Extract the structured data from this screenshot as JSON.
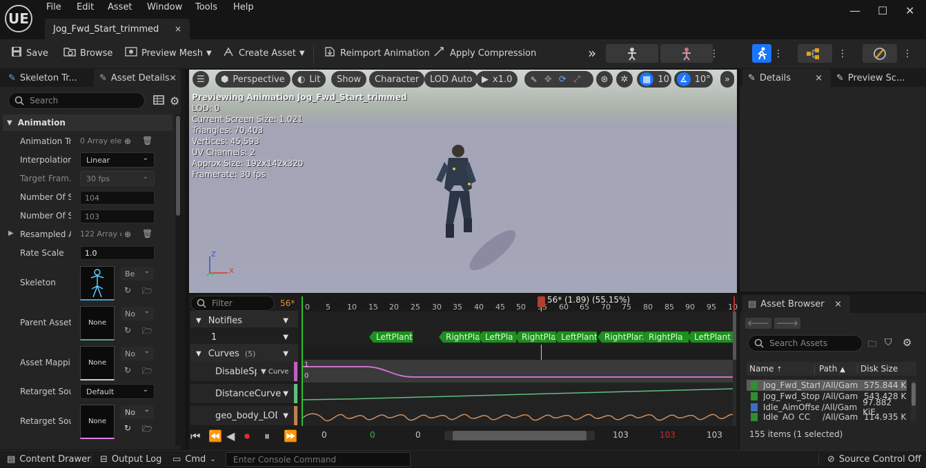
{
  "app": {
    "logo": "UE",
    "document_tab": "Jog_Fwd_Start_trimmed",
    "close_glyph": "×"
  },
  "menu": [
    "File",
    "Edit",
    "Asset",
    "Window",
    "Tools",
    "Help"
  ],
  "window_controls": {
    "minimize": "—",
    "maximize": "☐",
    "close": "✕"
  },
  "toolbar": {
    "save": "Save",
    "browse": "Browse",
    "preview_mesh": "Preview Mesh",
    "create_asset": "Create Asset",
    "reimport": "Reimport Animation",
    "apply_compression": "Apply Compression",
    "overflow": "»"
  },
  "left_panel": {
    "tabs": [
      "Skeleton Tr...",
      "Asset Details"
    ],
    "search_placeholder": "Search",
    "section": "Animation",
    "props": {
      "animation_track_label": "Animation Tr...",
      "animation_track_value": "0 Array ele",
      "interpolation_label": "Interpolation",
      "interpolation_value": "Linear",
      "target_frame_label": "Target Fram...",
      "target_frame_value": "30 fps",
      "num_sampled_keys_label": "Number Of S...",
      "num_sampled_keys_value": "104",
      "num_sampled_frames_label": "Number Of S...",
      "num_sampled_frames_value": "103",
      "resampled_label": "Resampled A...",
      "resampled_value": "122 Array e",
      "rate_scale_label": "Rate Scale",
      "rate_scale_value": "1.0",
      "skeleton_label": "Skeleton",
      "skeleton_combo": "Be",
      "parent_asset_label": "Parent Asset",
      "parent_asset_thumb": "None",
      "parent_asset_combo": "No",
      "asset_mapping_label": "Asset Mappi...",
      "asset_mapping_thumb": "None",
      "asset_mapping_combo": "No",
      "retarget_source_label": "Retarget Sou...",
      "retarget_source_value": "Default",
      "retarget_source_asset_label": "Retarget Sou...",
      "retarget_source_asset_thumb": "None",
      "retarget_source_asset_combo": "No"
    }
  },
  "viewport": {
    "buttons": {
      "perspective": "Perspective",
      "lit": "Lit",
      "show": "Show",
      "character": "Character",
      "lod": "LOD Auto",
      "speed": "x1.0",
      "grid": "10",
      "angle": "10°"
    },
    "hud": [
      "Previewing Animation Jog_Fwd_Start_trimmed",
      "LOD: 0",
      "Current Screen Size: 1.021",
      "Triangles: 70,403",
      "Vertices: 45,593",
      "UV Channels: 2",
      "Approx Size: 192x142x320",
      "Framerate: 30 fps"
    ],
    "axis": {
      "z": "Z",
      "x": "X",
      "y": "Y"
    }
  },
  "timeline": {
    "filter_placeholder": "Filter",
    "current_frame": "56*",
    "scrub_label": "56* (1.89) (55.15%)",
    "ticks": [
      "0",
      "5",
      "10",
      "15",
      "20",
      "25",
      "30",
      "35",
      "40",
      "45",
      "50",
      "55",
      "60",
      "65",
      "70",
      "75",
      "80",
      "85",
      "90",
      "95",
      "10"
    ],
    "notifies_label": "Notifies",
    "notify_track": "1",
    "notifies": [
      "LeftPlant",
      "RightPla",
      "LeftPla",
      "RightPla",
      "LeftPlant",
      "RightPlan",
      "RightPla",
      "LeftPlant"
    ],
    "curves_label": "Curves",
    "curves_count": "(5)",
    "curves": [
      {
        "name": "DisableSpe",
        "type": "Curve",
        "color": "#c060c0"
      },
      {
        "name": "DistanceCurve",
        "color": "#60c080"
      },
      {
        "name": "geo_body_LOD(",
        "color": "#c08050"
      }
    ],
    "curve_scale_top": "1",
    "curve_scale_bottom": "0",
    "frames": {
      "start": "0",
      "green": "0",
      "view_start": "0",
      "view_end": "103",
      "red": "103",
      "end": "103"
    }
  },
  "right_panel": {
    "tabs": [
      "Details",
      "Preview Sc..."
    ]
  },
  "asset_browser": {
    "tab": "Asset Browser",
    "search_placeholder": "Search Assets",
    "columns": [
      "Name",
      "Path",
      "Disk Size"
    ],
    "rows": [
      {
        "name": "Jog_Fwd_Start",
        "path": "/All/Gam",
        "size": "575.844 K",
        "selected": true
      },
      {
        "name": "Jog_Fwd_Stop",
        "path": "/All/Gam",
        "size": "543.428 K",
        "selected": false
      },
      {
        "name": "Idle_AimOffset",
        "path": "/All/Gam",
        "size": "97.882 KiE",
        "selected": false
      },
      {
        "name": "Idle_AO_CC",
        "path": "/All/Gam",
        "size": "114.935 K",
        "selected": false
      }
    ],
    "status": "155 items (1 selected)"
  },
  "statusbar": {
    "content_drawer": "Content Drawer",
    "output_log": "Output Log",
    "cmd": "Cmd",
    "console_placeholder": "Enter Console Command",
    "source_control": "Source Control Off"
  }
}
